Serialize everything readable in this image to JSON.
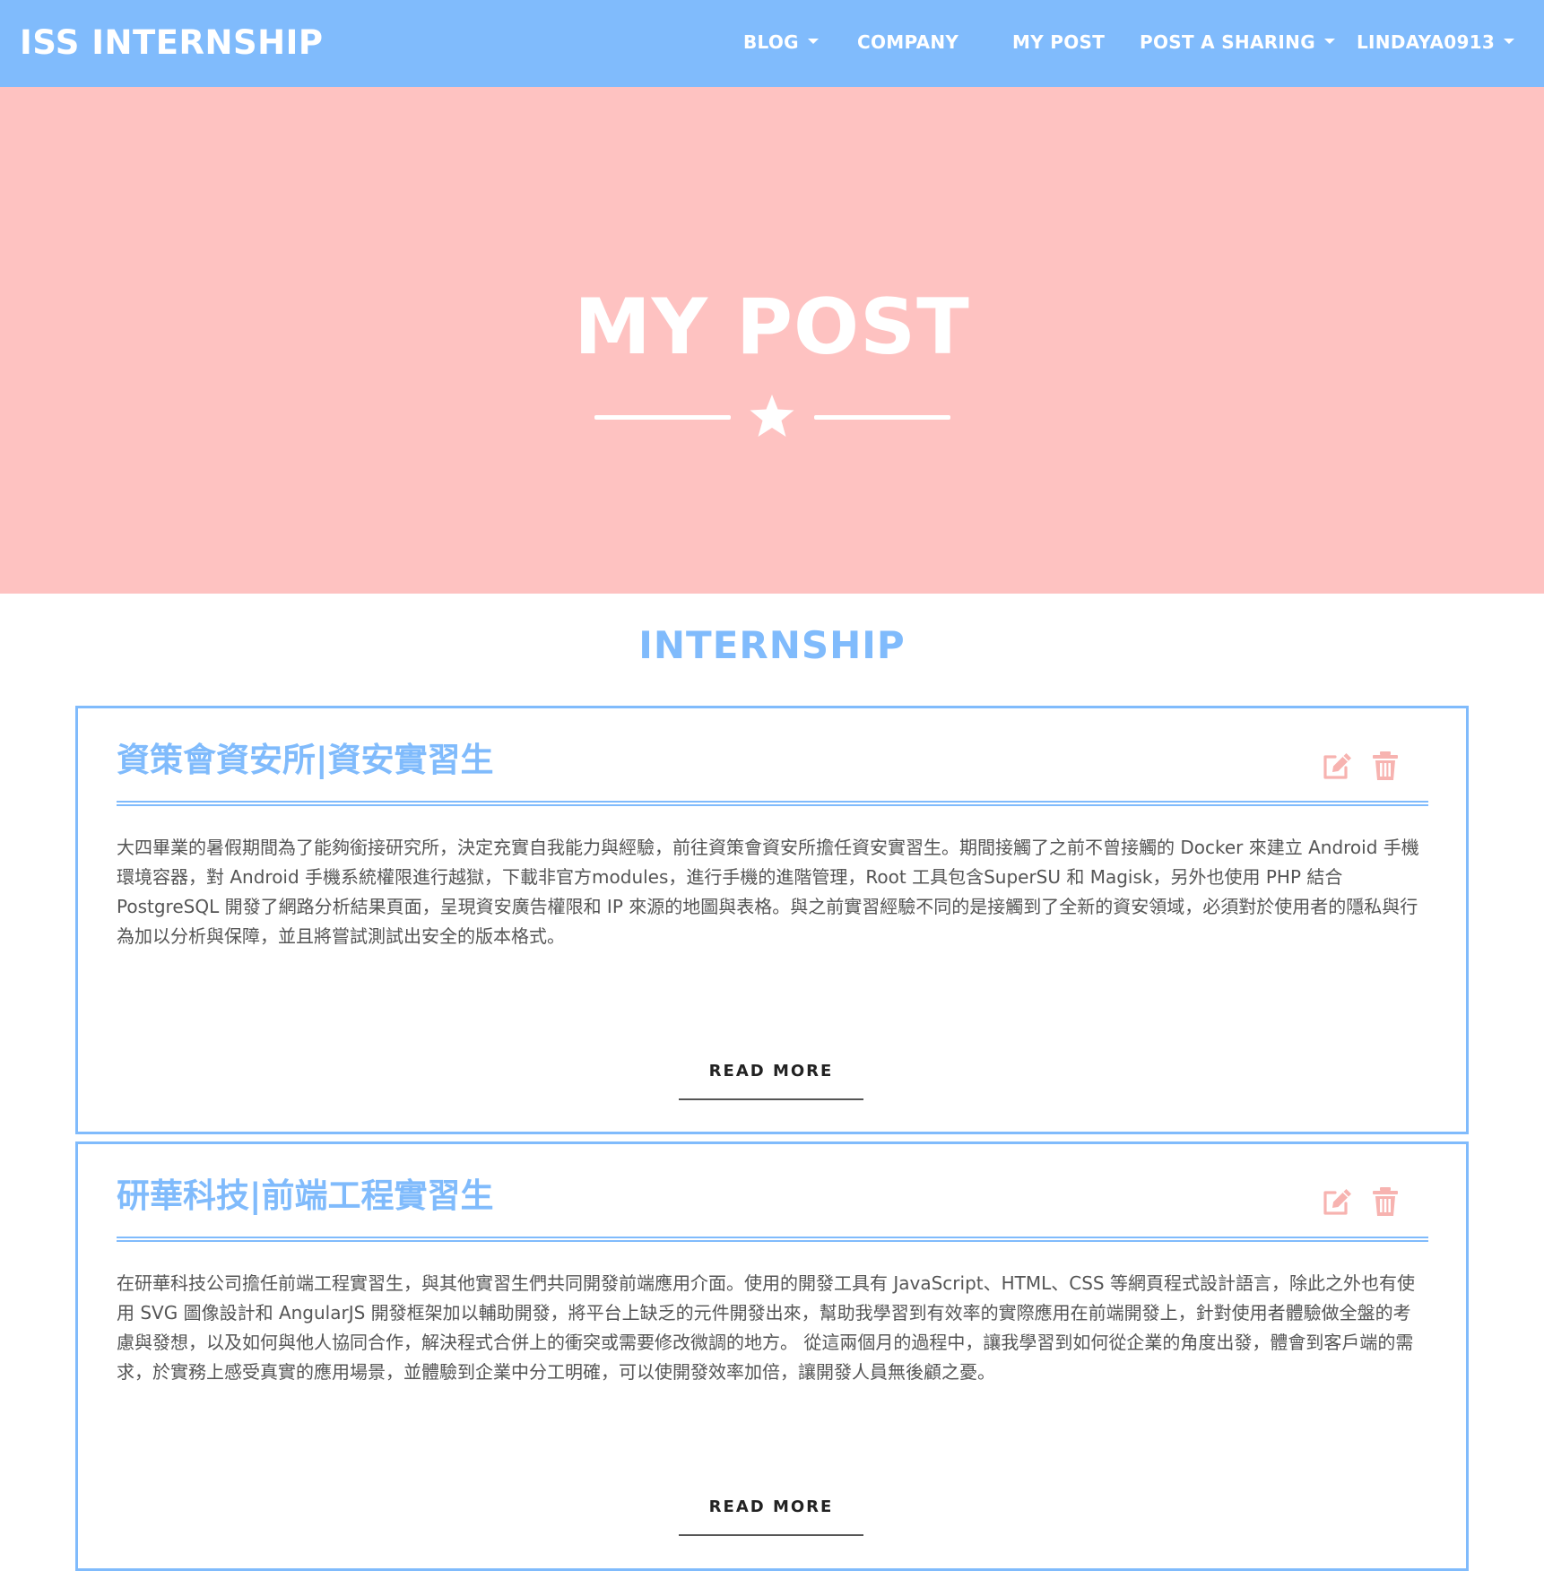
{
  "navbar": {
    "brand": "ISS INTERNSHIP",
    "items": [
      {
        "label": "BLOG",
        "dropdown": true
      },
      {
        "label": "COMPANY",
        "dropdown": false
      },
      {
        "label": "MY POST",
        "dropdown": false
      },
      {
        "label": "POST A SHARING",
        "dropdown": true
      },
      {
        "label": "LINDAYA0913",
        "dropdown": true
      }
    ]
  },
  "hero": {
    "title": "MY POST",
    "divider_icon": "star-icon"
  },
  "section": {
    "title": "INTERNSHIP"
  },
  "posts": [
    {
      "title": "資策會資安所|資安實習生",
      "body": "大四畢業的暑假期間為了能夠銜接研究所，決定充實自我能力與經驗，前往資策會資安所擔任資安實習生。期間接觸了之前不曾接觸的 Docker 來建立 Android 手機環境容器，對 Android 手機系統權限進行越獄，下載非官方modules，進行手機的進階管理，Root 工具包含SuperSU 和 Magisk，另外也使用 PHP 結合 PostgreSQL 開發了網路分析結果頁面，呈現資安廣告權限和 IP 來源的地圖與表格。與之前實習經驗不同的是接觸到了全新的資安領域，必須對於使用者的隱私與行為加以分析與保障，並且將嘗試測試出安全的版本格式。",
      "read_more": "READ MORE",
      "edit_icon": "edit-icon",
      "delete_icon": "trash-icon"
    },
    {
      "title": "研華科技|前端工程實習生",
      "body": "在研華科技公司擔任前端工程實習生，與其他實習生們共同開發前端應用介面。使用的開發工具有 JavaScript、HTML、CSS 等網頁程式設計語言，除此之外也有使用 SVG 圖像設計和 AngularJS 開發框架加以輔助開發，將平台上缺乏的元件開發出來，幫助我學習到有效率的實際應用在前端開發上，針對使用者體驗做全盤的考慮與發想，以及如何與他人協同合作，解決程式合併上的衝突或需要修改微調的地方。 從這兩個月的過程中，讓我學習到如何從企業的角度出發，體會到客戶端的需求，於實務上感受真實的應用場景，並體驗到企業中分工明確，可以使開發效率加倍，讓開發人員無後顧之憂。",
      "read_more": "READ MORE",
      "edit_icon": "edit-icon",
      "delete_icon": "trash-icon"
    }
  ],
  "colors": {
    "navbar_bg": "#80bbfc",
    "hero_bg": "#fec2c1",
    "accent_blue": "#80bbfc",
    "action_pink": "#f7b3b0",
    "body_text": "#555555"
  }
}
